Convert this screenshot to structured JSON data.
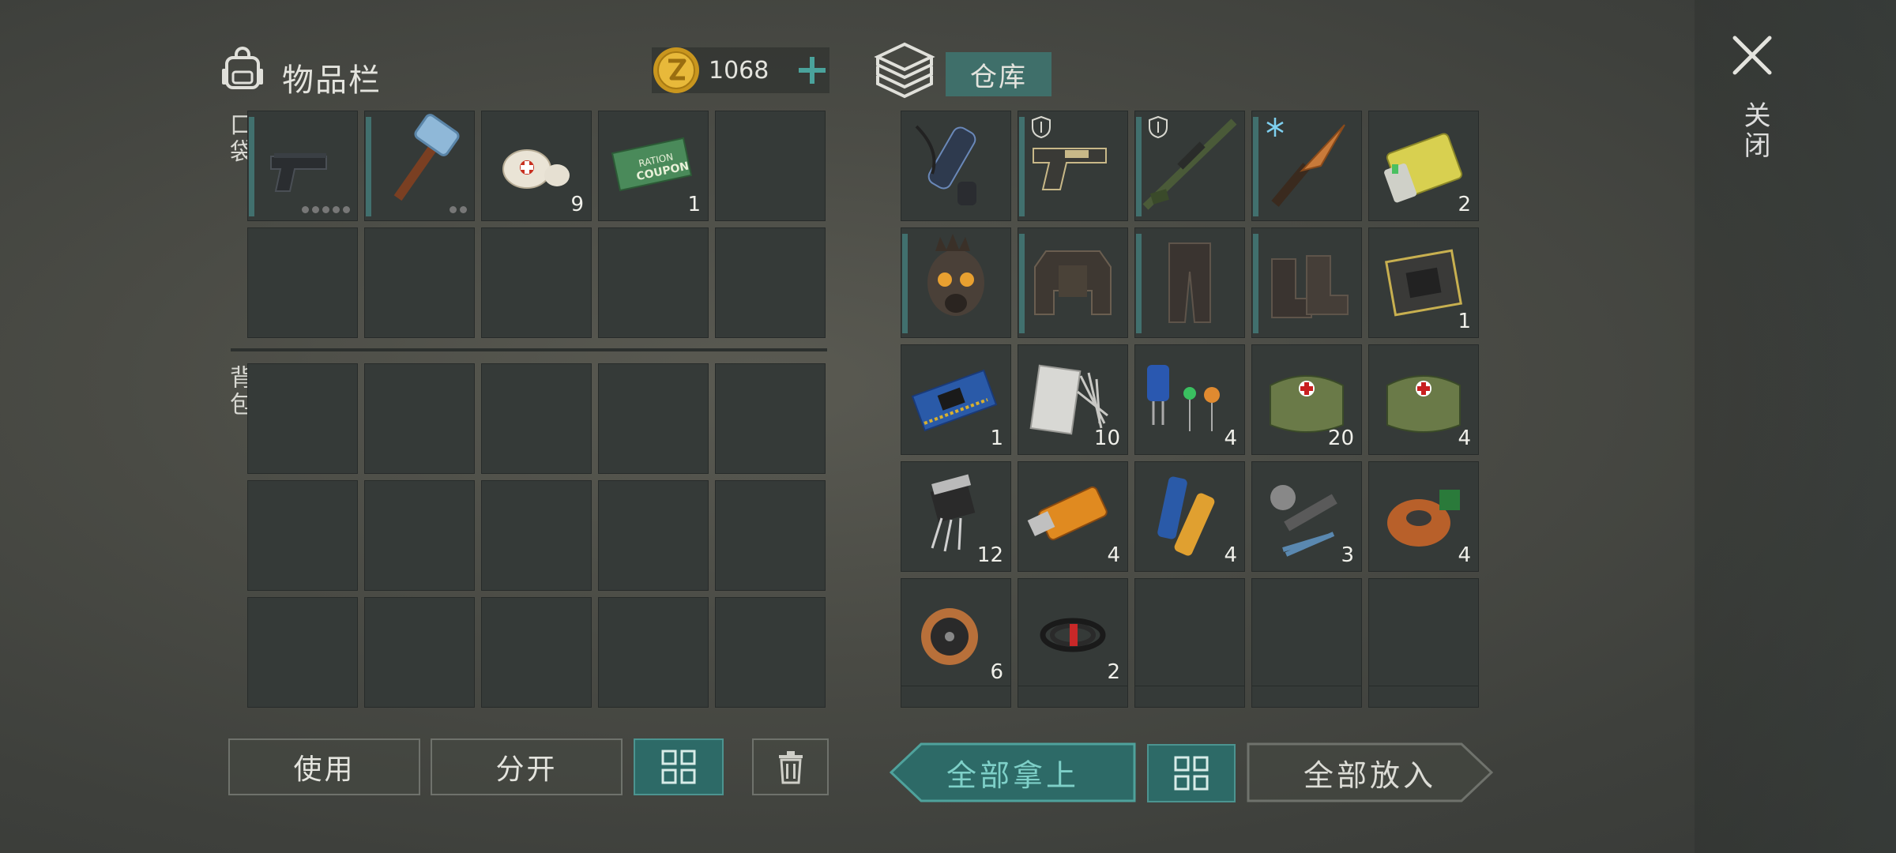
{
  "inventory": {
    "title": "物品栏",
    "coins": "1068",
    "pocket_label": "口袋",
    "backpack_label": "背包",
    "pocket_slots": [
      {
        "item": "pistol-icon",
        "qty": "",
        "bar": true,
        "dots": 5
      },
      {
        "item": "sledgehammer-icon",
        "qty": "",
        "bar": true,
        "dots": 2
      },
      {
        "item": "bandage-icon",
        "qty": "9",
        "bar": false,
        "dots": 0
      },
      {
        "item": "ration-coupon-icon",
        "qty": "1",
        "bar": false,
        "dots": 0
      },
      {
        "item": "",
        "qty": "",
        "bar": false,
        "dots": 0
      },
      {
        "item": "",
        "qty": "",
        "bar": false,
        "dots": 0
      },
      {
        "item": "",
        "qty": "",
        "bar": false,
        "dots": 0
      },
      {
        "item": "",
        "qty": "",
        "bar": false,
        "dots": 0
      },
      {
        "item": "",
        "qty": "",
        "bar": false,
        "dots": 0
      },
      {
        "item": "",
        "qty": "",
        "bar": false,
        "dots": 0
      }
    ],
    "coupon_text": [
      "RATION",
      "COUPON"
    ]
  },
  "buttons": {
    "use": "使用",
    "split": "分开",
    "take_all": "全部拿上",
    "put_all": "全部放入"
  },
  "warehouse": {
    "tab": "仓库",
    "slots": [
      {
        "item": "silencer-icon",
        "qty": "",
        "bar": false,
        "badge": ""
      },
      {
        "item": "desert-pistol-icon",
        "qty": "",
        "bar": true,
        "badge": "shield"
      },
      {
        "item": "sniper-rifle-icon",
        "qty": "",
        "bar": true,
        "badge": "shield"
      },
      {
        "item": "combat-knife-icon",
        "qty": "",
        "bar": true,
        "badge": "frost"
      },
      {
        "item": "battery-icon",
        "qty": "2",
        "bar": false,
        "badge": ""
      },
      {
        "item": "gas-mask-helmet-icon",
        "qty": "",
        "bar": true,
        "badge": ""
      },
      {
        "item": "armor-vest-icon",
        "qty": "",
        "bar": true,
        "badge": ""
      },
      {
        "item": "armor-pants-icon",
        "qty": "",
        "bar": true,
        "badge": ""
      },
      {
        "item": "armor-boots-icon",
        "qty": "",
        "bar": true,
        "badge": ""
      },
      {
        "item": "processor-icon",
        "qty": "1",
        "bar": false,
        "badge": ""
      },
      {
        "item": "circuit-board-icon",
        "qty": "1",
        "bar": false,
        "badge": ""
      },
      {
        "item": "fiberglass-icon",
        "qty": "10",
        "bar": false,
        "badge": ""
      },
      {
        "item": "capacitors-icon",
        "qty": "4",
        "bar": false,
        "badge": ""
      },
      {
        "item": "medkit-icon",
        "qty": "20",
        "bar": false,
        "badge": ""
      },
      {
        "item": "medkit-icon",
        "qty": "4",
        "bar": false,
        "badge": ""
      },
      {
        "item": "transistor-icon",
        "qty": "12",
        "bar": false,
        "badge": ""
      },
      {
        "item": "usb-drive-icon",
        "qty": "4",
        "bar": false,
        "badge": ""
      },
      {
        "item": "batteries-icon",
        "qty": "4",
        "bar": false,
        "badge": ""
      },
      {
        "item": "tool-kit-icon",
        "qty": "3",
        "bar": false,
        "badge": ""
      },
      {
        "item": "copper-coil-icon",
        "qty": "4",
        "bar": false,
        "badge": ""
      },
      {
        "item": "wire-spool-icon",
        "qty": "6",
        "bar": false,
        "badge": ""
      },
      {
        "item": "cable-icon",
        "qty": "2",
        "bar": false,
        "badge": ""
      },
      {
        "item": "",
        "qty": "",
        "bar": false,
        "badge": ""
      },
      {
        "item": "",
        "qty": "",
        "bar": false,
        "badge": ""
      },
      {
        "item": "",
        "qty": "",
        "bar": false,
        "badge": ""
      }
    ]
  },
  "close_label": "关闭",
  "colors": {
    "accent": "#2d6a67",
    "slot": "#353a38",
    "bar": "#41706e"
  }
}
